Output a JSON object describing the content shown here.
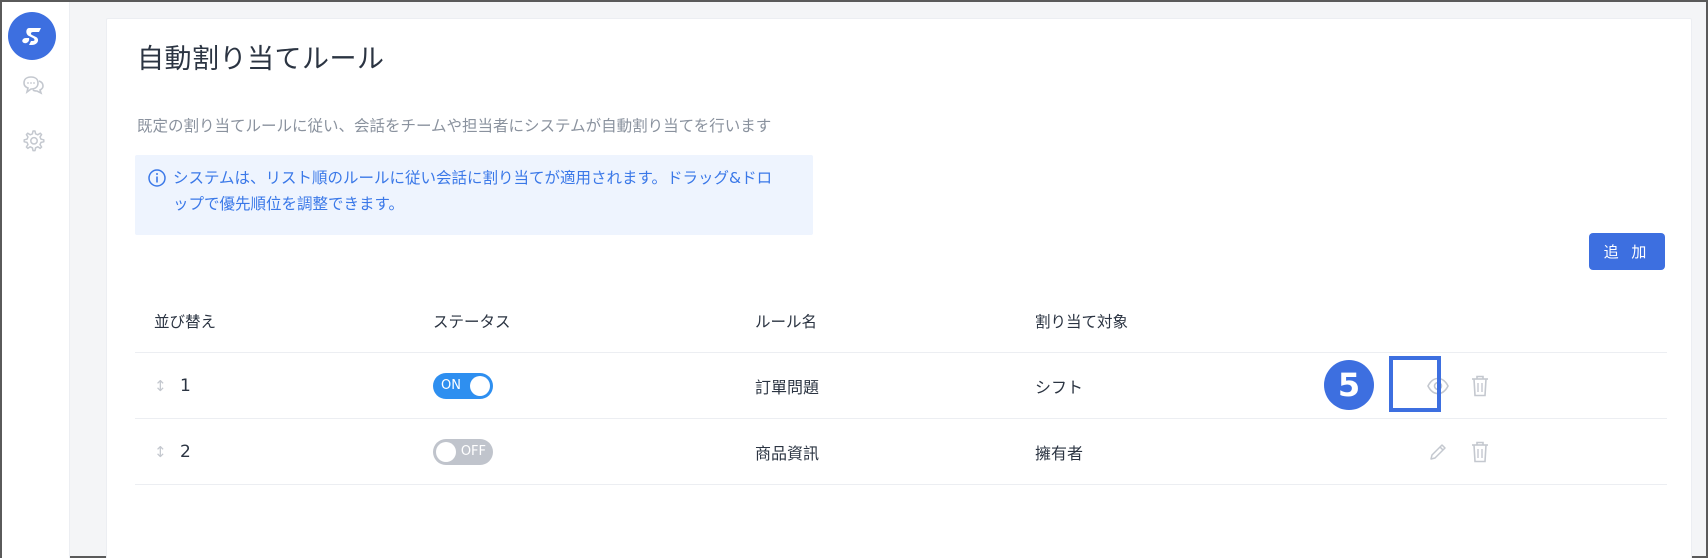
{
  "sidebar": {
    "logo_icon": "app-logo",
    "items": [
      {
        "icon": "chat-icon"
      },
      {
        "icon": "gear-icon"
      }
    ]
  },
  "page": {
    "title": "自動割り当てルール",
    "description": "既定の割り当てルールに従い、会話をチームや担当者にシステムが自動割り当てを行います",
    "info_line1": "システムは、リスト順のルールに従い会話に割り当てが適用されます。ドラッグ&ドロ",
    "info_line2": "ップで優先順位を調整できます。",
    "add_button": "追 加"
  },
  "table": {
    "headers": {
      "sort": "並び替え",
      "status": "ステータス",
      "name": "ルール名",
      "target": "割り当て対象"
    },
    "rows": [
      {
        "order": "1",
        "status": "ON",
        "status_on": true,
        "name": "訂單問題",
        "target": "シフト",
        "action_icons": [
          "eye-icon",
          "trash-icon"
        ]
      },
      {
        "order": "2",
        "status": "OFF",
        "status_on": false,
        "name": "商品資訊",
        "target": "擁有者",
        "action_icons": [
          "pencil-icon",
          "trash-icon"
        ]
      }
    ]
  },
  "annotation": {
    "step_number": "5"
  },
  "colors": {
    "accent": "#3d6fe0",
    "toggle_on": "#2e8ff0",
    "toggle_off": "#c0c4cc",
    "info_bg": "#eef4fe",
    "info_text": "#3a78e8"
  }
}
